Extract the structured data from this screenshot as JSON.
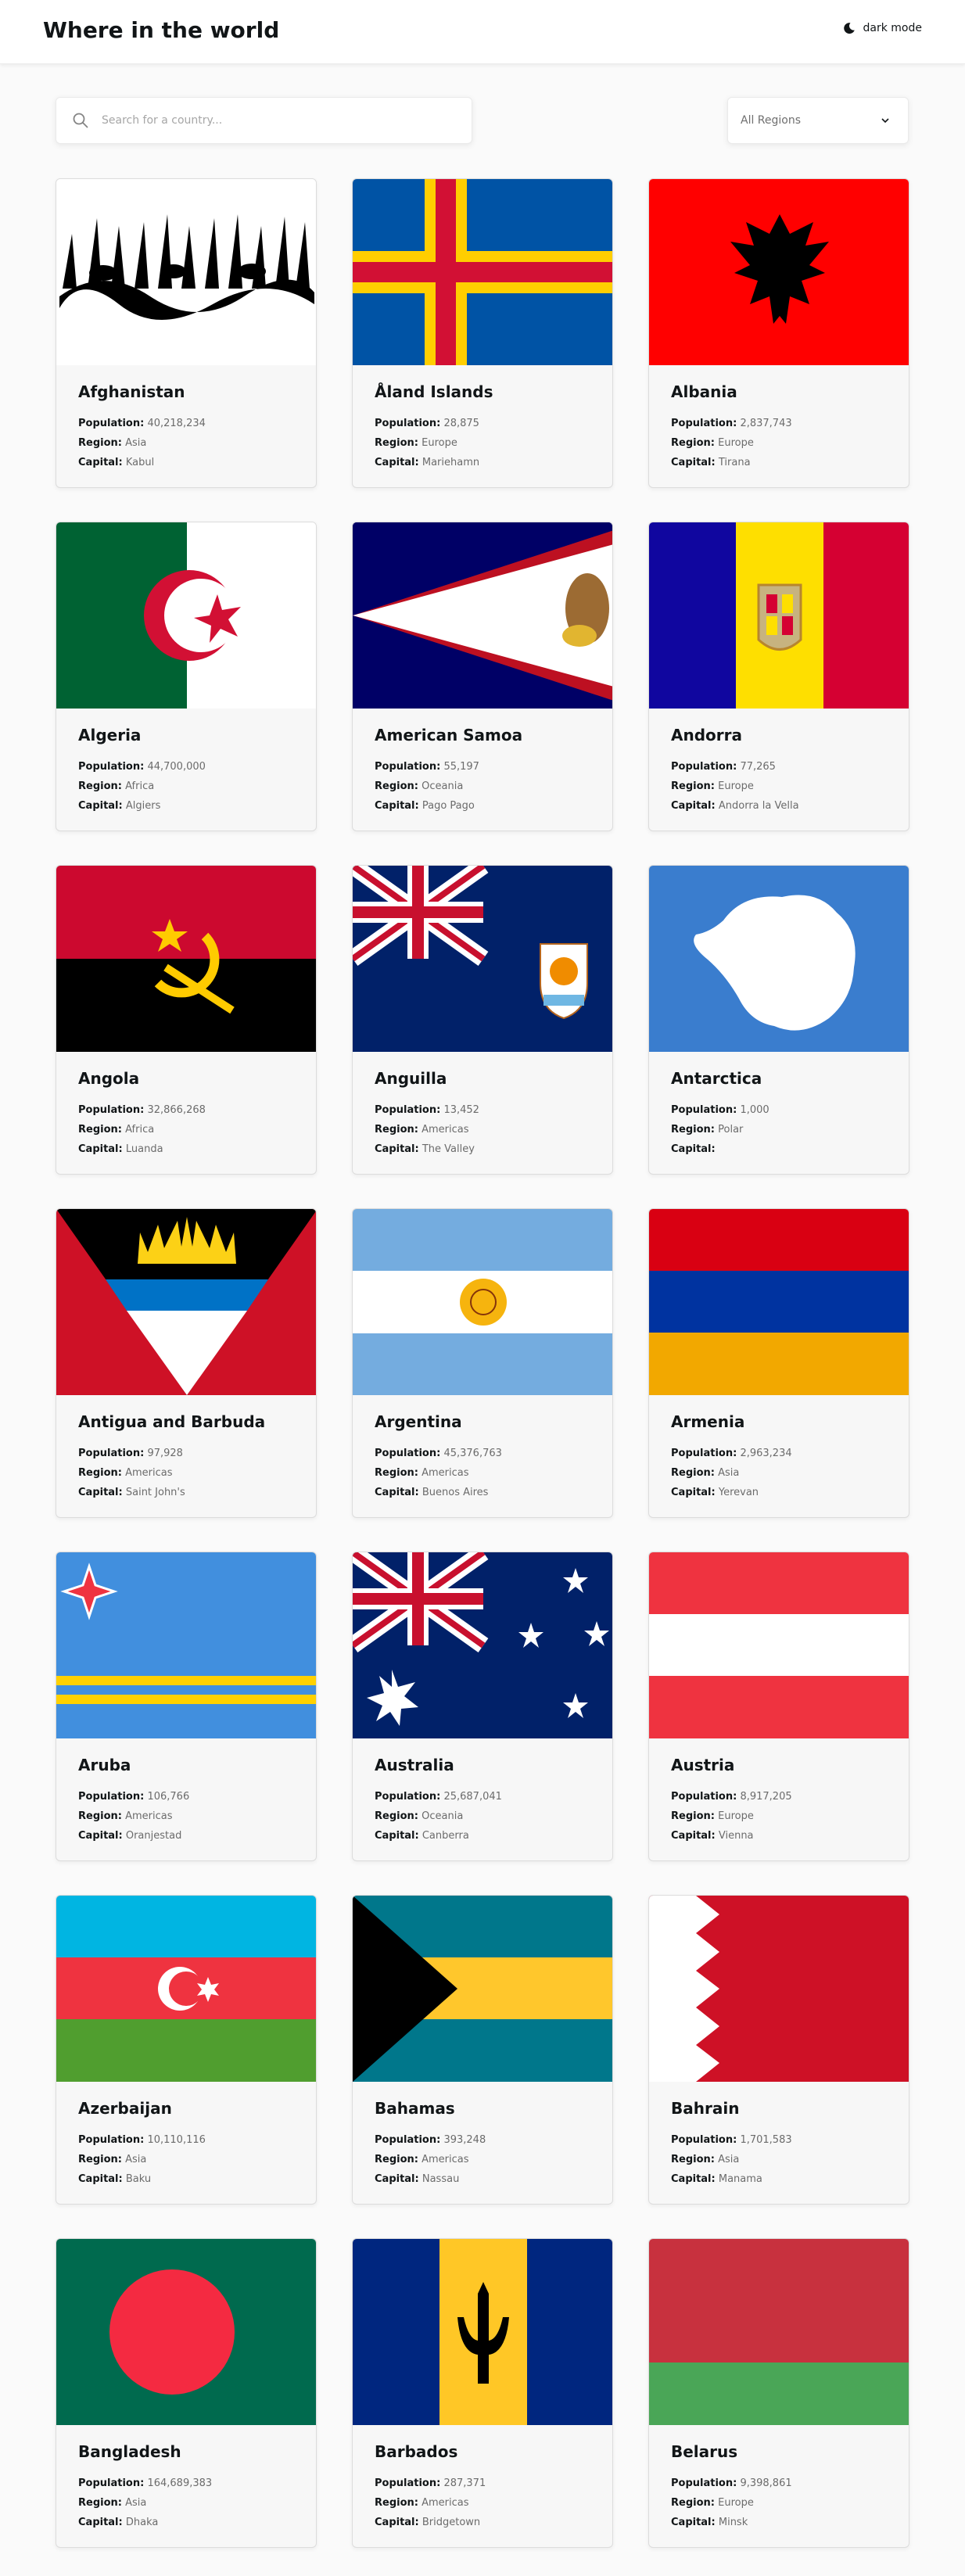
{
  "header": {
    "title": "Where in the world",
    "mode_label": "dark mode"
  },
  "search": {
    "placeholder": "Search for a country..."
  },
  "filter": {
    "label": "All Regions"
  },
  "labels": {
    "population": "Population:",
    "region": "Region:",
    "capital": "Capital:"
  },
  "countries": [
    {
      "name": "Afghanistan",
      "population": "40,218,234",
      "region": "Asia",
      "capital": "Kabul",
      "flag": "afghanistan-flag-icon"
    },
    {
      "name": "Åland Islands",
      "population": "28,875",
      "region": "Europe",
      "capital": "Mariehamn",
      "flag": "aland-flag-icon"
    },
    {
      "name": "Albania",
      "population": "2,837,743",
      "region": "Europe",
      "capital": "Tirana",
      "flag": "albania-flag-icon"
    },
    {
      "name": "Algeria",
      "population": "44,700,000",
      "region": "Africa",
      "capital": "Algiers",
      "flag": "algeria-flag-icon"
    },
    {
      "name": "American Samoa",
      "population": "55,197",
      "region": "Oceania",
      "capital": "Pago Pago",
      "flag": "american-samoa-flag-icon"
    },
    {
      "name": "Andorra",
      "population": "77,265",
      "region": "Europe",
      "capital": "Andorra la Vella",
      "flag": "andorra-flag-icon"
    },
    {
      "name": "Angola",
      "population": "32,866,268",
      "region": "Africa",
      "capital": "Luanda",
      "flag": "angola-flag-icon"
    },
    {
      "name": "Anguilla",
      "population": "13,452",
      "region": "Americas",
      "capital": "The Valley",
      "flag": "anguilla-flag-icon"
    },
    {
      "name": "Antarctica",
      "population": "1,000",
      "region": "Polar",
      "capital": "",
      "flag": "antarctica-flag-icon"
    },
    {
      "name": "Antigua and Barbuda",
      "population": "97,928",
      "region": "Americas",
      "capital": "Saint John's",
      "flag": "antigua-flag-icon"
    },
    {
      "name": "Argentina",
      "population": "45,376,763",
      "region": "Americas",
      "capital": "Buenos Aires",
      "flag": "argentina-flag-icon"
    },
    {
      "name": "Armenia",
      "population": "2,963,234",
      "region": "Asia",
      "capital": "Yerevan",
      "flag": "armenia-flag-icon"
    },
    {
      "name": "Aruba",
      "population": "106,766",
      "region": "Americas",
      "capital": "Oranjestad",
      "flag": "aruba-flag-icon"
    },
    {
      "name": "Australia",
      "population": "25,687,041",
      "region": "Oceania",
      "capital": "Canberra",
      "flag": "australia-flag-icon"
    },
    {
      "name": "Austria",
      "population": "8,917,205",
      "region": "Europe",
      "capital": "Vienna",
      "flag": "austria-flag-icon"
    },
    {
      "name": "Azerbaijan",
      "population": "10,110,116",
      "region": "Asia",
      "capital": "Baku",
      "flag": "azerbaijan-flag-icon"
    },
    {
      "name": "Bahamas",
      "population": "393,248",
      "region": "Americas",
      "capital": "Nassau",
      "flag": "bahamas-flag-icon"
    },
    {
      "name": "Bahrain",
      "population": "1,701,583",
      "region": "Asia",
      "capital": "Manama",
      "flag": "bahrain-flag-icon"
    },
    {
      "name": "Bangladesh",
      "population": "164,689,383",
      "region": "Asia",
      "capital": "Dhaka",
      "flag": "bangladesh-flag-icon"
    },
    {
      "name": "Barbados",
      "population": "287,371",
      "region": "Americas",
      "capital": "Bridgetown",
      "flag": "barbados-flag-icon"
    },
    {
      "name": "Belarus",
      "population": "9,398,861",
      "region": "Europe",
      "capital": "Minsk",
      "flag": "belarus-flag-icon"
    }
  ]
}
